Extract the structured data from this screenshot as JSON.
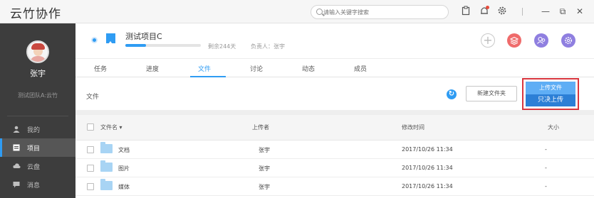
{
  "app": {
    "title": "云竹协作"
  },
  "search": {
    "placeholder": "请输入关键字搜索"
  },
  "titlebar": {
    "minimize": "—",
    "restore": "⧉",
    "close": "✕"
  },
  "sidebar": {
    "user_name": "张宇",
    "team": "测试团队A:云竹",
    "items": [
      {
        "label": "我的",
        "icon": "user-icon",
        "active": false
      },
      {
        "label": "项目",
        "icon": "project-icon",
        "active": true
      },
      {
        "label": "云盘",
        "icon": "cloud-icon",
        "active": false
      },
      {
        "label": "消息",
        "icon": "message-icon",
        "active": false
      }
    ]
  },
  "project": {
    "name": "测试项目C",
    "progress": 0.27,
    "remaining": "剩余244天",
    "owner": "负责人：张宇"
  },
  "tabs": [
    {
      "label": "任务",
      "active": false
    },
    {
      "label": "进度",
      "active": false
    },
    {
      "label": "文件",
      "active": true
    },
    {
      "label": "讨论",
      "active": false
    },
    {
      "label": "动态",
      "active": false
    },
    {
      "label": "成员",
      "active": false
    }
  ],
  "toolbar": {
    "breadcrumb": "文件",
    "new_folder": "新建文件夹",
    "upload_file": "上传文件",
    "upload_folder": "只决上传"
  },
  "table": {
    "headers": {
      "name": "文件名",
      "uploader": "上传者",
      "modified": "修改时间",
      "size": "大小"
    },
    "rows": [
      {
        "name": "文档",
        "uploader": "张宇",
        "modified": "2017/10/26 11:34",
        "size": "-"
      },
      {
        "name": "图片",
        "uploader": "张宇",
        "modified": "2017/10/26 11:34",
        "size": "-"
      },
      {
        "name": "媒体",
        "uploader": "张宇",
        "modified": "2017/10/26 11:34",
        "size": "-"
      }
    ]
  },
  "colors": {
    "accent": "#2f9cf3",
    "highlight_border": "#d9363e",
    "sidebar_bg": "#3d3d3d"
  }
}
